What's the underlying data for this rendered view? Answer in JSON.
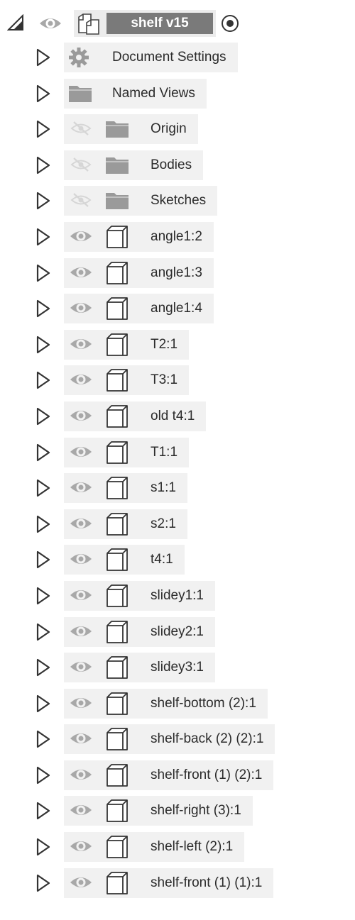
{
  "root": {
    "title": "shelf v15",
    "visible": true,
    "active": true
  },
  "items": [
    {
      "label": "Document Settings",
      "kind": "settings",
      "visible": true
    },
    {
      "label": "Named Views",
      "kind": "folder",
      "visible": true
    },
    {
      "label": "Origin",
      "kind": "folder",
      "visible": false
    },
    {
      "label": "Bodies",
      "kind": "folder",
      "visible": false
    },
    {
      "label": "Sketches",
      "kind": "folder",
      "visible": false
    },
    {
      "label": "angle1:2",
      "kind": "component",
      "visible": true
    },
    {
      "label": "angle1:3",
      "kind": "component",
      "visible": true
    },
    {
      "label": "angle1:4",
      "kind": "component",
      "visible": true
    },
    {
      "label": "T2:1",
      "kind": "component",
      "visible": true
    },
    {
      "label": "T3:1",
      "kind": "component",
      "visible": true
    },
    {
      "label": "old t4:1",
      "kind": "component",
      "visible": true
    },
    {
      "label": "T1:1",
      "kind": "component",
      "visible": true
    },
    {
      "label": "s1:1",
      "kind": "component",
      "visible": true
    },
    {
      "label": "s2:1",
      "kind": "component",
      "visible": true
    },
    {
      "label": "t4:1",
      "kind": "component",
      "visible": true
    },
    {
      "label": "slidey1:1",
      "kind": "component",
      "visible": true
    },
    {
      "label": "slidey2:1",
      "kind": "component",
      "visible": true
    },
    {
      "label": "slidey3:1",
      "kind": "component",
      "visible": true
    },
    {
      "label": "shelf-bottom (2):1",
      "kind": "component",
      "visible": true
    },
    {
      "label": "shelf-back (2) (2):1",
      "kind": "component",
      "visible": true
    },
    {
      "label": "shelf-front (1) (2):1",
      "kind": "component",
      "visible": true
    },
    {
      "label": "shelf-right (3):1",
      "kind": "component",
      "visible": true
    },
    {
      "label": "shelf-left (2):1",
      "kind": "component",
      "visible": true
    },
    {
      "label": "shelf-front (1) (1):1",
      "kind": "component",
      "visible": true
    }
  ],
  "icons": {
    "expand": "expand-triangle-icon",
    "collapse": "collapse-triangle-icon",
    "eye": "eye-icon",
    "eye_hidden": "eye-hidden-icon",
    "gear": "gear-icon",
    "folder": "folder-icon",
    "component": "component-cube-icon",
    "radio": "active-radio-icon"
  },
  "colors": {
    "root_title_bg": "#7a7a7a",
    "row_bg": "#f1f1f1",
    "icon_gray": "#9a9a9a",
    "icon_light": "#cfcfcf",
    "text": "#2b2b2b"
  }
}
